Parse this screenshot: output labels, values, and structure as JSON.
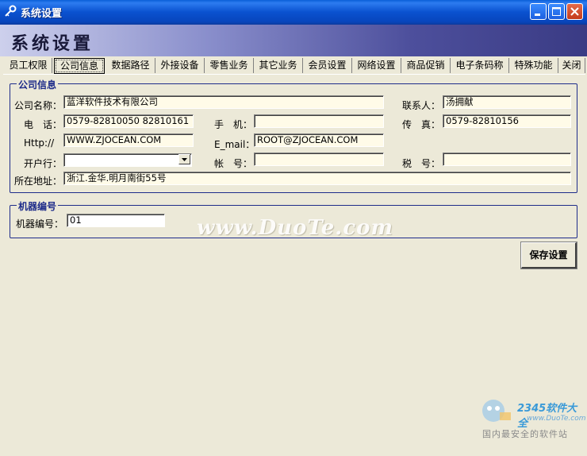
{
  "window": {
    "title": "系统设置"
  },
  "banner": {
    "title": "系统设置"
  },
  "tabs": [
    "员工权限",
    "公司信息",
    "数据路径",
    "外接设备",
    "零售业务",
    "其它业务",
    "会员设置",
    "网络设置",
    "商品促销",
    "电子条码称",
    "特殊功能",
    "关闭"
  ],
  "active_tab": "公司信息",
  "company": {
    "group_title": "公司信息",
    "name_label": "公司名称：",
    "name_value": "蓝洋软件技术有限公司",
    "contact_label": "联系人：",
    "contact_value": "汤拥献",
    "phone_label": "电　话：",
    "phone_value": "0579-82810050 82810161",
    "mobile_label": "手　机：",
    "mobile_value": "",
    "fax_label": "传　真：",
    "fax_value": "0579-82810156",
    "http_label": "Http://",
    "http_value": "WWW.ZJOCEAN.COM",
    "email_label": "E_mail：",
    "email_value": "ROOT@ZJOCEAN.COM",
    "bank_label": "开户行：",
    "bank_value": "",
    "account_label": "帐　号：",
    "account_value": "",
    "tax_label": "税　号：",
    "tax_value": "",
    "address_label": "所在地址：",
    "address_value": "浙江.金华.明月南街55号"
  },
  "machine": {
    "group_title": "机器编号",
    "label": "机器编号：",
    "value": "01"
  },
  "save_button": "保存设置",
  "watermark": "www.DuoTe.com",
  "brand": {
    "line1": "2345软件大全",
    "line2": "www.DuoTe.com",
    "line3": "国内最安全的软件站"
  }
}
